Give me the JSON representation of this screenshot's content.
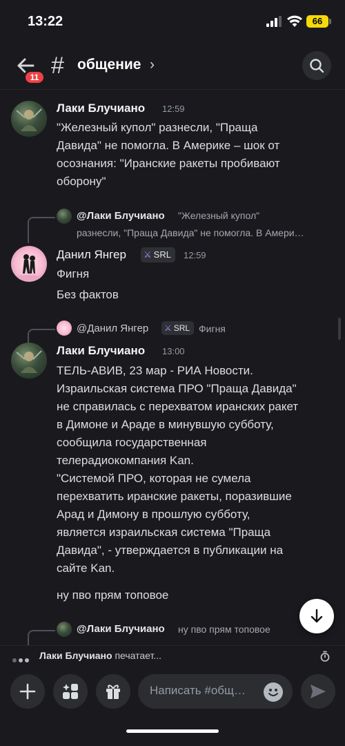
{
  "status_bar": {
    "time": "13:22",
    "battery": "66"
  },
  "header": {
    "back_badge": "11",
    "hash_symbol": "#",
    "channel_name": "общение",
    "chevron": "›",
    "icons": {
      "back": "arrow-left-icon",
      "search": "search-icon"
    }
  },
  "messages": [
    {
      "author": "Лаки Блучиано",
      "time": "12:59",
      "lines": [
        "\"Железный купол\" разнесли, \"Праща",
        "Давида\" не помогла. В Америке – шок от",
        "осознания: \"Иранские ракеты пробивают",
        "оборону\""
      ]
    },
    {
      "reply": {
        "author": "@Лаки Блучиано",
        "text_line1": "\"Железный купол\"",
        "text_line2": "разнесли, \"Праща Давида\" не помогла. В Амери…"
      },
      "author": "Данил Янгер",
      "tag": "SRL",
      "time": "12:59",
      "lines": [
        "Фигня"
      ],
      "followups": [
        "Без фактов"
      ]
    },
    {
      "reply": {
        "author": "@Данил Янгер",
        "tag": "SRL",
        "text": "Фигня"
      },
      "author": "Лаки Блучиано",
      "time": "13:00",
      "lines": [
        "ТЕЛЬ-АВИВ, 23 мар - РИА Новости.",
        "Израильская система ПРО \"Праща Давида\"",
        "не справилась с перехватом иранских ракет",
        "в Димоне и Араде в минувшую субботу,",
        "сообщила государственная",
        "телерадиокомпания Kan.",
        "\"Системой ПРО, которая не сумела",
        "перехватить иранские ракеты, поразившие",
        "Арад и Димону в прошлую субботу,",
        "является израильская система \"Праща",
        "Давида\", - утверждается в публикации на",
        "сайте Kan."
      ],
      "followups": [
        "ну пво прям топовое"
      ]
    },
    {
      "reply": {
        "author": "@Лаки Блучиано",
        "text": "ну пво прям топовое"
      }
    }
  ],
  "typing": {
    "who": "Лаки Блучиано",
    "suffix": "печатает..."
  },
  "composer": {
    "placeholder": "Написать #общ…",
    "icons": [
      "plus-icon",
      "apps-icon",
      "gift-icon",
      "emoji-icon",
      "send-icon"
    ]
  },
  "colors": {
    "badge": "#ed4245",
    "background": "#1a1a1e",
    "tag_icon": "#a78bfa"
  }
}
